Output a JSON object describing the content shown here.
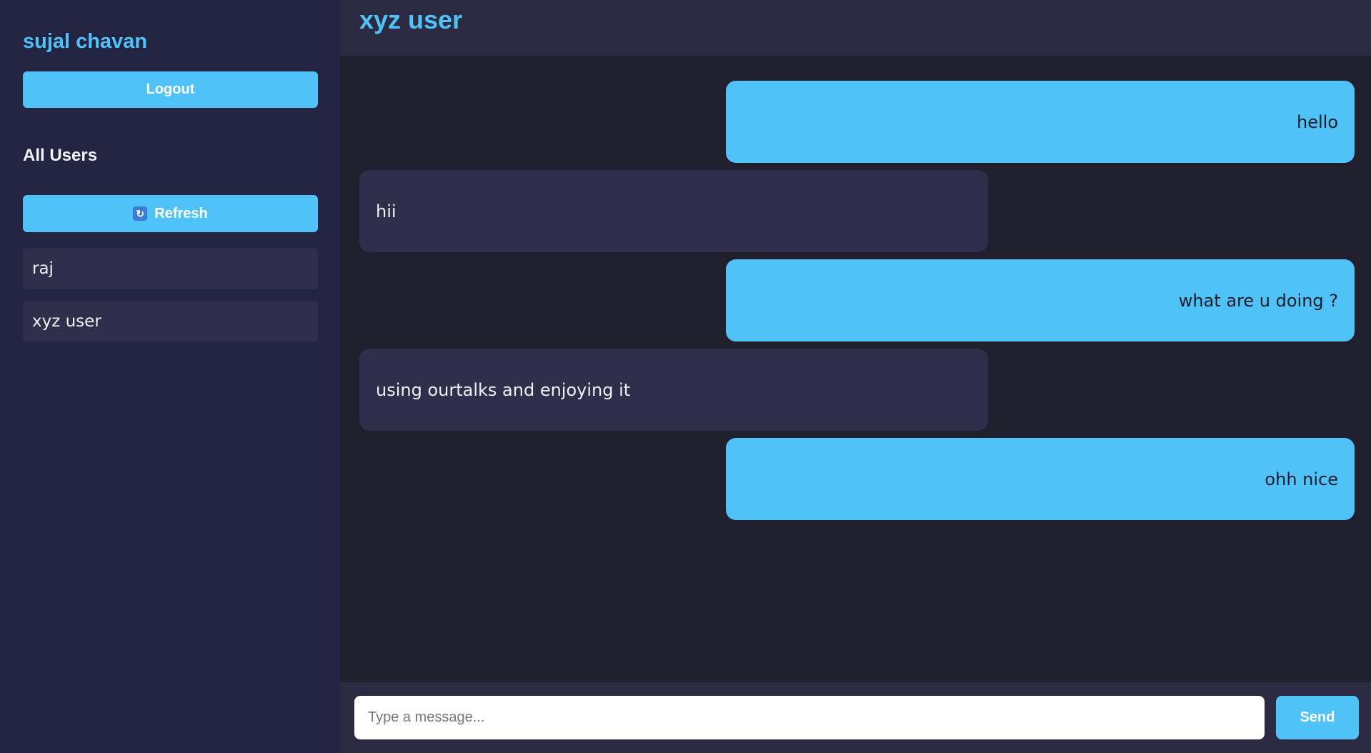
{
  "sidebar": {
    "current_user": "sujal chavan",
    "logout_label": "Logout",
    "section_title": "All Users",
    "refresh_icon": "refresh-icon",
    "refresh_label": "Refresh",
    "users": [
      "raj",
      "xyz user"
    ]
  },
  "chat": {
    "title": "xyz user",
    "messages": [
      {
        "direction": "sent",
        "text": "hello"
      },
      {
        "direction": "received",
        "text": "hii"
      },
      {
        "direction": "sent",
        "text": "what are u doing ?"
      },
      {
        "direction": "received",
        "text": "using ourtalks and enjoying it"
      },
      {
        "direction": "sent",
        "text": "ohh nice"
      }
    ]
  },
  "composer": {
    "placeholder": "Type a message...",
    "value": "",
    "send_label": "Send"
  },
  "colors": {
    "accent": "#4fc3f7",
    "sidebar_bg": "#232342",
    "main_bg": "#1f1f2e",
    "bubble_received": "#2f2e4b"
  }
}
